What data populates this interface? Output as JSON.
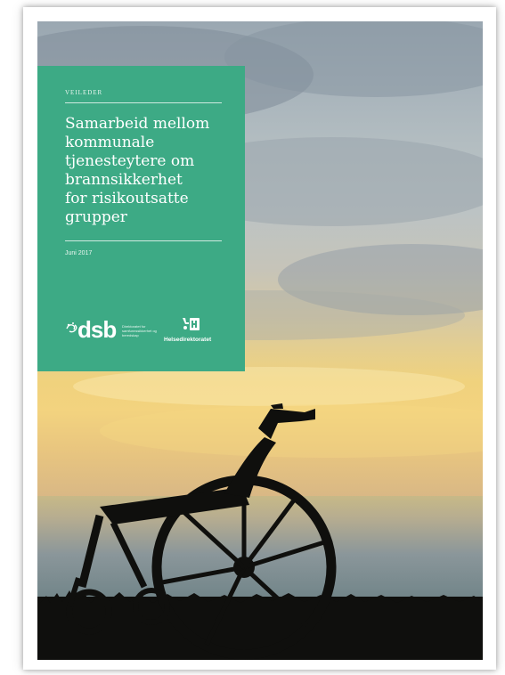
{
  "cover": {
    "kicker": "VEILEDER",
    "title_lines": [
      "Samarbeid mellom",
      "kommunale",
      "tjenesteytere om",
      "brannsikkerhet",
      "for risikoutsatte",
      "grupper"
    ],
    "date": "Juni 2017"
  },
  "logos": {
    "dsb": {
      "wordmark": "dsb",
      "subtitle": "Direktoratet for samfunnssikkerhet og beredskap",
      "icon": "dsb-swirl-icon"
    },
    "helsedirektoratet": {
      "name": "Helsedirektoratet",
      "icon": "helsedirektoratet-icon"
    }
  },
  "colors": {
    "panel": "#3daa85",
    "panel_text": "#ffffff",
    "silhouette": "#0f0f0d"
  }
}
